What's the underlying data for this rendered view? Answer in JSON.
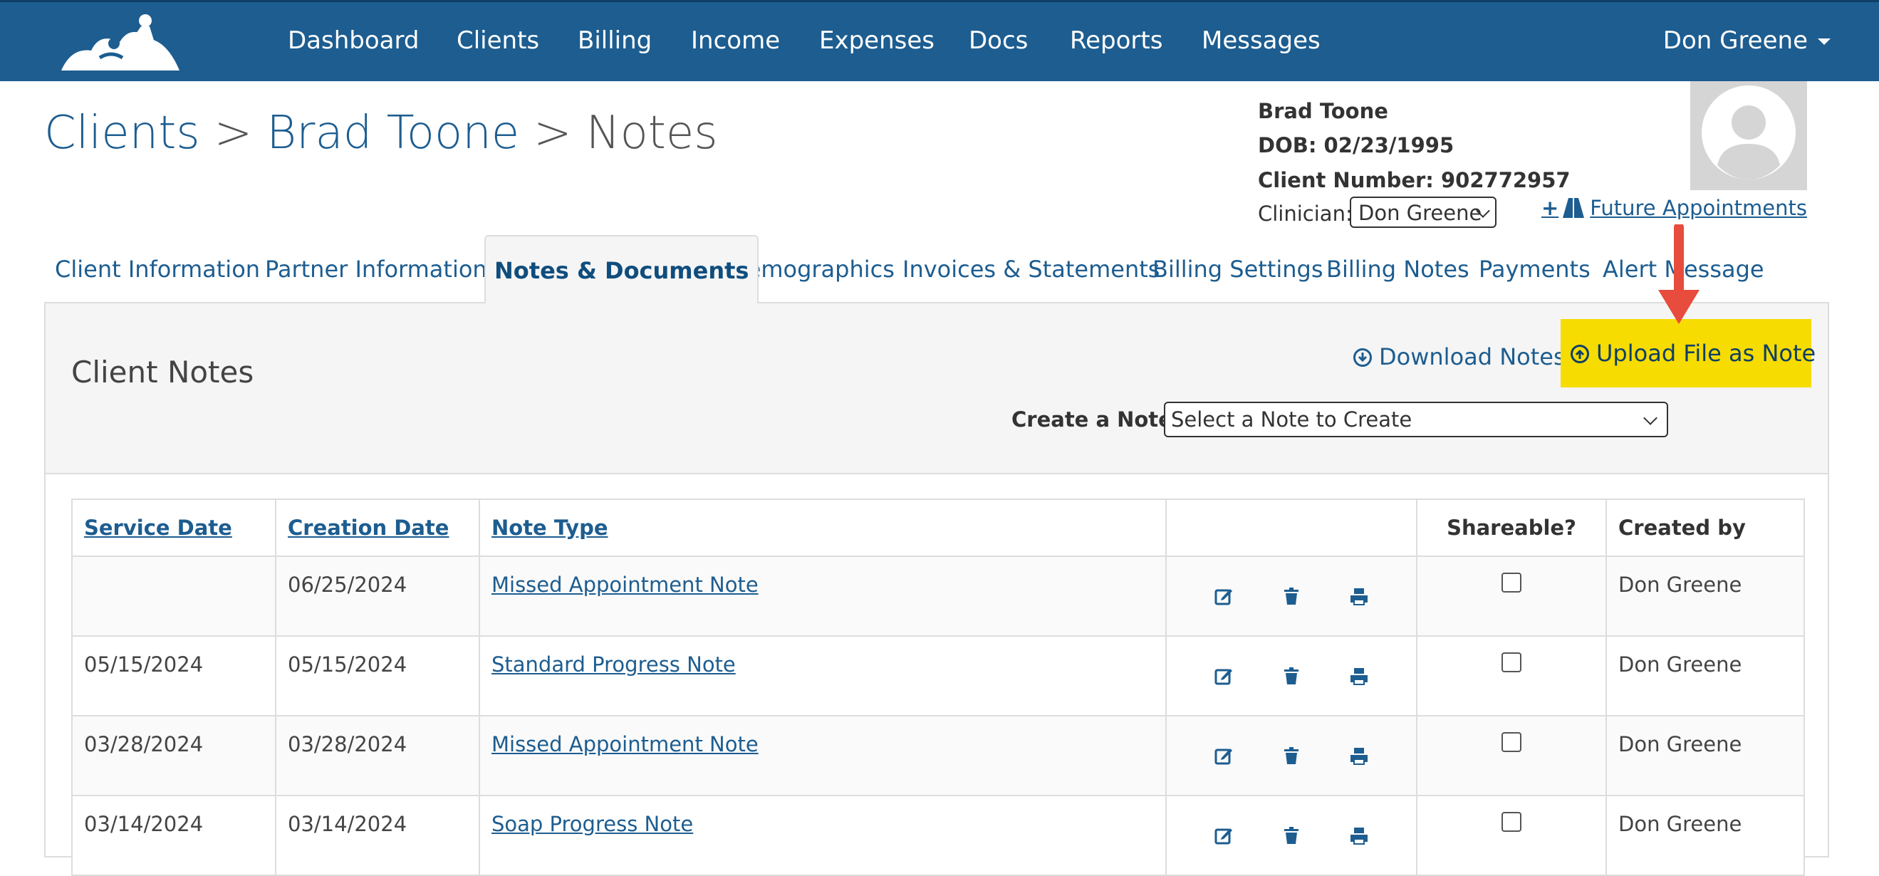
{
  "nav": {
    "items": [
      "Dashboard",
      "Clients",
      "Billing",
      "Income",
      "Expenses",
      "Docs",
      "Reports",
      "Messages"
    ],
    "user": "Don Greene"
  },
  "breadcrumb": {
    "clients": "Clients",
    "sep1": ">",
    "client": "Brad Toone",
    "sep2": ">",
    "current": "Notes"
  },
  "client": {
    "name": "Brad Toone",
    "dob": "DOB: 02/23/1995",
    "number": "Client Number: 902772957",
    "clinician_label": "Clinician:",
    "clinician_value": "Don Greene"
  },
  "future_appointments": {
    "plus": "+",
    "label": "Future Appointments"
  },
  "tabs": [
    "Client Information",
    "Partner Information",
    "Notes & Documents",
    "Demographics",
    "Invoices & Statements",
    "Billing Settings",
    "Billing Notes",
    "Payments",
    "Alert Message"
  ],
  "panel": {
    "title": "Client Notes",
    "download": "Download Notes",
    "upload": "Upload File as Note",
    "create_label": "Create a Note:",
    "create_placeholder": "Select a Note to Create"
  },
  "table": {
    "headers": [
      "Service Date",
      "Creation Date",
      "Note Type",
      "",
      "Shareable?",
      "Created by"
    ],
    "rows": [
      {
        "service": "",
        "creation": "06/25/2024",
        "type": "Missed Appointment Note",
        "created_by": "Don Greene"
      },
      {
        "service": "05/15/2024",
        "creation": "05/15/2024",
        "type": "Standard Progress Note",
        "created_by": "Don Greene"
      },
      {
        "service": "03/28/2024",
        "creation": "03/28/2024",
        "type": "Missed Appointment Note",
        "created_by": "Don Greene"
      },
      {
        "service": "03/14/2024",
        "creation": "03/14/2024",
        "type": "Soap Progress Note",
        "created_by": "Don Greene"
      }
    ]
  },
  "colors": {
    "nav_bg": "#1d5d90",
    "link": "#1d5d90",
    "highlight": "#f6dc00",
    "arrow": "#e74c3c"
  }
}
